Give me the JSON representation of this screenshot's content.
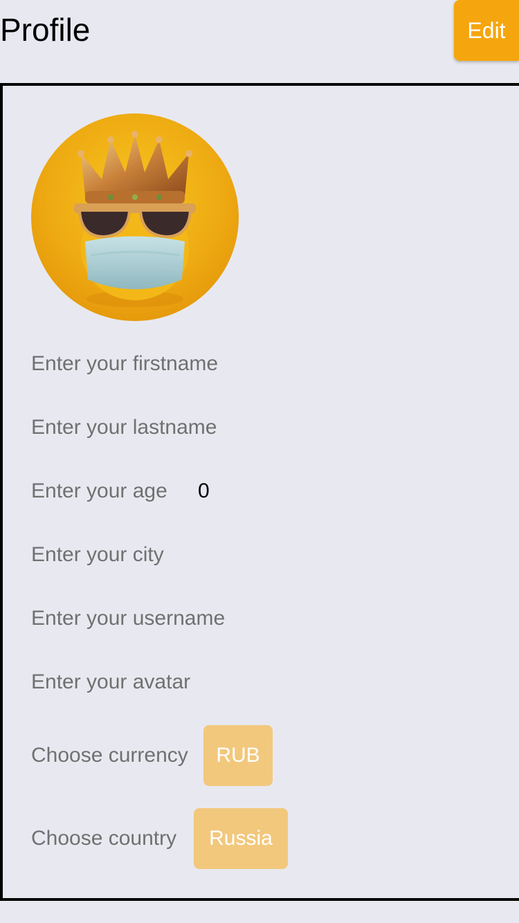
{
  "header": {
    "title": "Profile",
    "edit_label": "Edit"
  },
  "colors": {
    "accent": "#f5a60f",
    "pill": "#f2c87d",
    "background": "#e8e9f0"
  },
  "form": {
    "firstname_placeholder": "Enter your firstname",
    "lastname_placeholder": "Enter your lastname",
    "age_label": "Enter your age",
    "age_value": "0",
    "city_placeholder": "Enter your city",
    "username_placeholder": "Enter your username",
    "avatar_placeholder": "Enter your avatar",
    "currency_label": "Choose currency",
    "currency_value": "RUB",
    "country_label": "Choose country",
    "country_value": "Russia"
  }
}
